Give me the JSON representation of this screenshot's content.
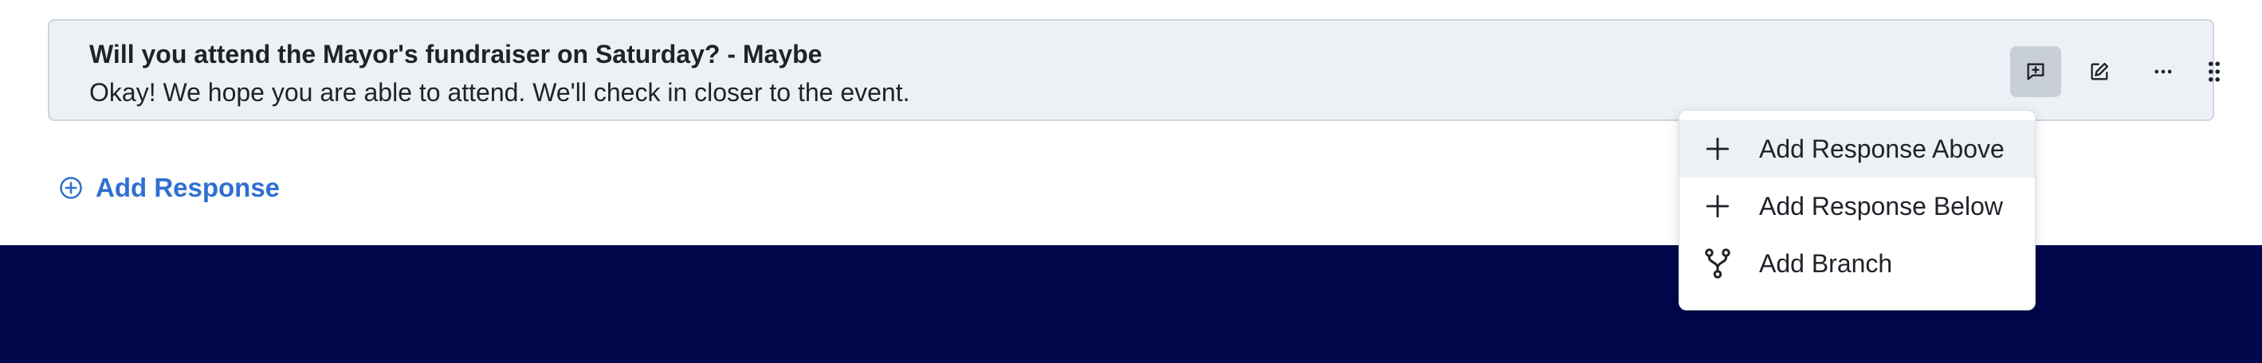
{
  "response": {
    "title": "Will you attend the Mayor's fundraiser on Saturday? - Maybe",
    "body": "Okay! We hope you are able to attend. We'll check in closer to the event."
  },
  "actions": {
    "icons": [
      "add-comment-icon",
      "edit-icon",
      "more-icon",
      "drag-handle-icon"
    ]
  },
  "add_response": {
    "label": "Add Response",
    "icon": "plus-circle-icon"
  },
  "menu": {
    "items": [
      {
        "label": "Add Response Above",
        "icon": "plus-icon"
      },
      {
        "label": "Add Response Below",
        "icon": "plus-icon"
      },
      {
        "label": "Add Branch",
        "icon": "branch-icon"
      }
    ]
  },
  "colors": {
    "card_background": "#edf0f5",
    "accent_blue": "#2f6fd0",
    "footer_navy": "#02064a"
  }
}
